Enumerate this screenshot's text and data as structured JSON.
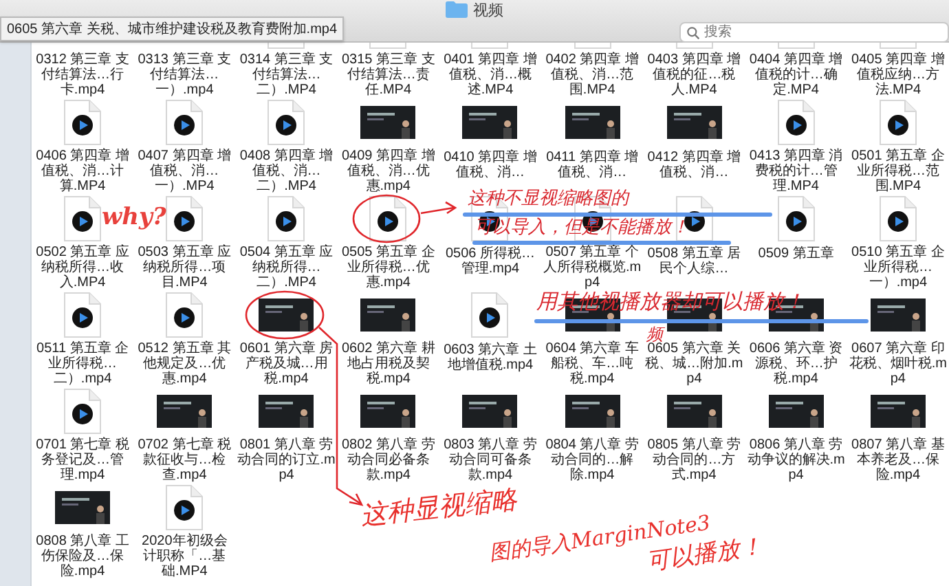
{
  "window": {
    "title": "视频"
  },
  "tooltip": "0605 第六章 关税、城市维护建设税及教育费附加.mp4",
  "search": {
    "placeholder": "搜索"
  },
  "files": [
    {
      "name": "0312 第三章 支付结算法…行卡.mp4",
      "kind": "thumbnail"
    },
    {
      "name": "0313 第三章 支付结算法…一）.mp4",
      "kind": "thumbnail"
    },
    {
      "name": "0314 第三章 支付结算法…二）.MP4",
      "kind": "video"
    },
    {
      "name": "0315 第三章 支付结算法…责任.MP4",
      "kind": "video"
    },
    {
      "name": "0401 第四章 增值税、消…概述.MP4",
      "kind": "video"
    },
    {
      "name": "0402 第四章 增值税、消…范围.MP4",
      "kind": "video"
    },
    {
      "name": "0403 第四章 增值税的征…税人.MP4",
      "kind": "video"
    },
    {
      "name": "0404 第四章 增值税的计…确定.MP4",
      "kind": "video"
    },
    {
      "name": "0405 第四章 增值税应纳…方法.MP4",
      "kind": "video"
    },
    {
      "name": "0406 第四章 增值税、消…计算.MP4",
      "kind": "video"
    },
    {
      "name": "0407 第四章 增值税、消…一）.MP4",
      "kind": "video"
    },
    {
      "name": "0408 第四章 增值税、消…二）.MP4",
      "kind": "video"
    },
    {
      "name": "0409 第四章 增值税、消…优惠.mp4",
      "kind": "thumbnail"
    },
    {
      "name": "0410 第四章 增值税、消…",
      "kind": "thumbnail"
    },
    {
      "name": "0411 第四章 增值税、消…",
      "kind": "thumbnail"
    },
    {
      "name": "0412 第四章 增值税、消…",
      "kind": "thumbnail"
    },
    {
      "name": "0413 第四章 消费税的计…管理.MP4",
      "kind": "video"
    },
    {
      "name": "0501 第五章 企业所得税…范围.MP4",
      "kind": "video"
    },
    {
      "name": "0502 第五章 应纳税所得…收入.MP4",
      "kind": "video"
    },
    {
      "name": "0503 第五章 应纳税所得…项目.MP4",
      "kind": "video"
    },
    {
      "name": "0504 第五章 应纳税所得…二）.MP4",
      "kind": "video"
    },
    {
      "name": "0505 第五章 企业所得税…优惠.mp4",
      "kind": "video"
    },
    {
      "name": "0506 所得税…管理.mp4",
      "kind": "video"
    },
    {
      "name": "0507 第五章 个人所得税概览.mp4",
      "kind": "video"
    },
    {
      "name": "0508 第五章 居民个人综…",
      "kind": "video"
    },
    {
      "name": "0509 第五章",
      "kind": "video"
    },
    {
      "name": "0510 第五章 企业所得税…一）.mp4",
      "kind": "video"
    },
    {
      "name": "0511 第五章 企业所得税…二）.mp4",
      "kind": "video"
    },
    {
      "name": "0512 第五章 其他规定及…优惠.mp4",
      "kind": "video"
    },
    {
      "name": "0601 第六章 房产税及城…用税.mp4",
      "kind": "thumbnail"
    },
    {
      "name": "0602 第六章 耕地占用税及契税.mp4",
      "kind": "thumbnail"
    },
    {
      "name": "0603 第六章 土地增值税.mp4",
      "kind": "video"
    },
    {
      "name": "0604 第六章 车船税、车…吨税.mp4",
      "kind": "thumbnail"
    },
    {
      "name": "0605 第六章 关税、城…附加.mp4",
      "kind": "thumbnail"
    },
    {
      "name": "0606 第六章 资源税、环…护税.mp4",
      "kind": "thumbnail"
    },
    {
      "name": "0607 第六章 印花税、烟叶税.mp4",
      "kind": "thumbnail"
    },
    {
      "name": "0701 第七章 税务登记及…管理.mp4",
      "kind": "video"
    },
    {
      "name": "0702 第七章 税款征收与…检查.mp4",
      "kind": "thumbnail"
    },
    {
      "name": "0801 第八章 劳动合同的订立.mp4",
      "kind": "thumbnail"
    },
    {
      "name": "0802 第八章 劳动合同必备条款.mp4",
      "kind": "thumbnail"
    },
    {
      "name": "0803 第八章 劳动合同可备条款.mp4",
      "kind": "thumbnail"
    },
    {
      "name": "0804 第八章 劳动合同的…解除.mp4",
      "kind": "thumbnail"
    },
    {
      "name": "0805 第八章 劳动合同的…方式.mp4",
      "kind": "thumbnail"
    },
    {
      "name": "0806 第八章 劳动争议的解决.mp4",
      "kind": "thumbnail"
    },
    {
      "name": "0807 第八章 基本养老及…保险.mp4",
      "kind": "thumbnail"
    },
    {
      "name": "0808 第八章 工伤保险及…保险.mp4",
      "kind": "thumbnail"
    },
    {
      "name": "2020年初级会计职称「…基础.MP4",
      "kind": "video"
    }
  ],
  "annotations": [
    {
      "text": "why?",
      "color": "#e8413c",
      "kind": "big"
    },
    {
      "text": "这种不显视缩略图的",
      "color": "#d9282f",
      "kind": "note"
    },
    {
      "text": "可以导入，但是不能播放！",
      "color": "#d9282f",
      "kind": "note"
    },
    {
      "text": "用其他视播放器却可以播放！",
      "color": "#d9282f",
      "kind": "note"
    },
    {
      "text": "频",
      "color": "#d9282f",
      "kind": "note"
    },
    {
      "text": "这种显视缩略",
      "color": "#e8302c",
      "kind": "note"
    },
    {
      "text": "图的导入MarginNote3",
      "color": "#e8302c",
      "kind": "note"
    },
    {
      "text": "可以播放！",
      "color": "#e8302c",
      "kind": "note"
    }
  ]
}
